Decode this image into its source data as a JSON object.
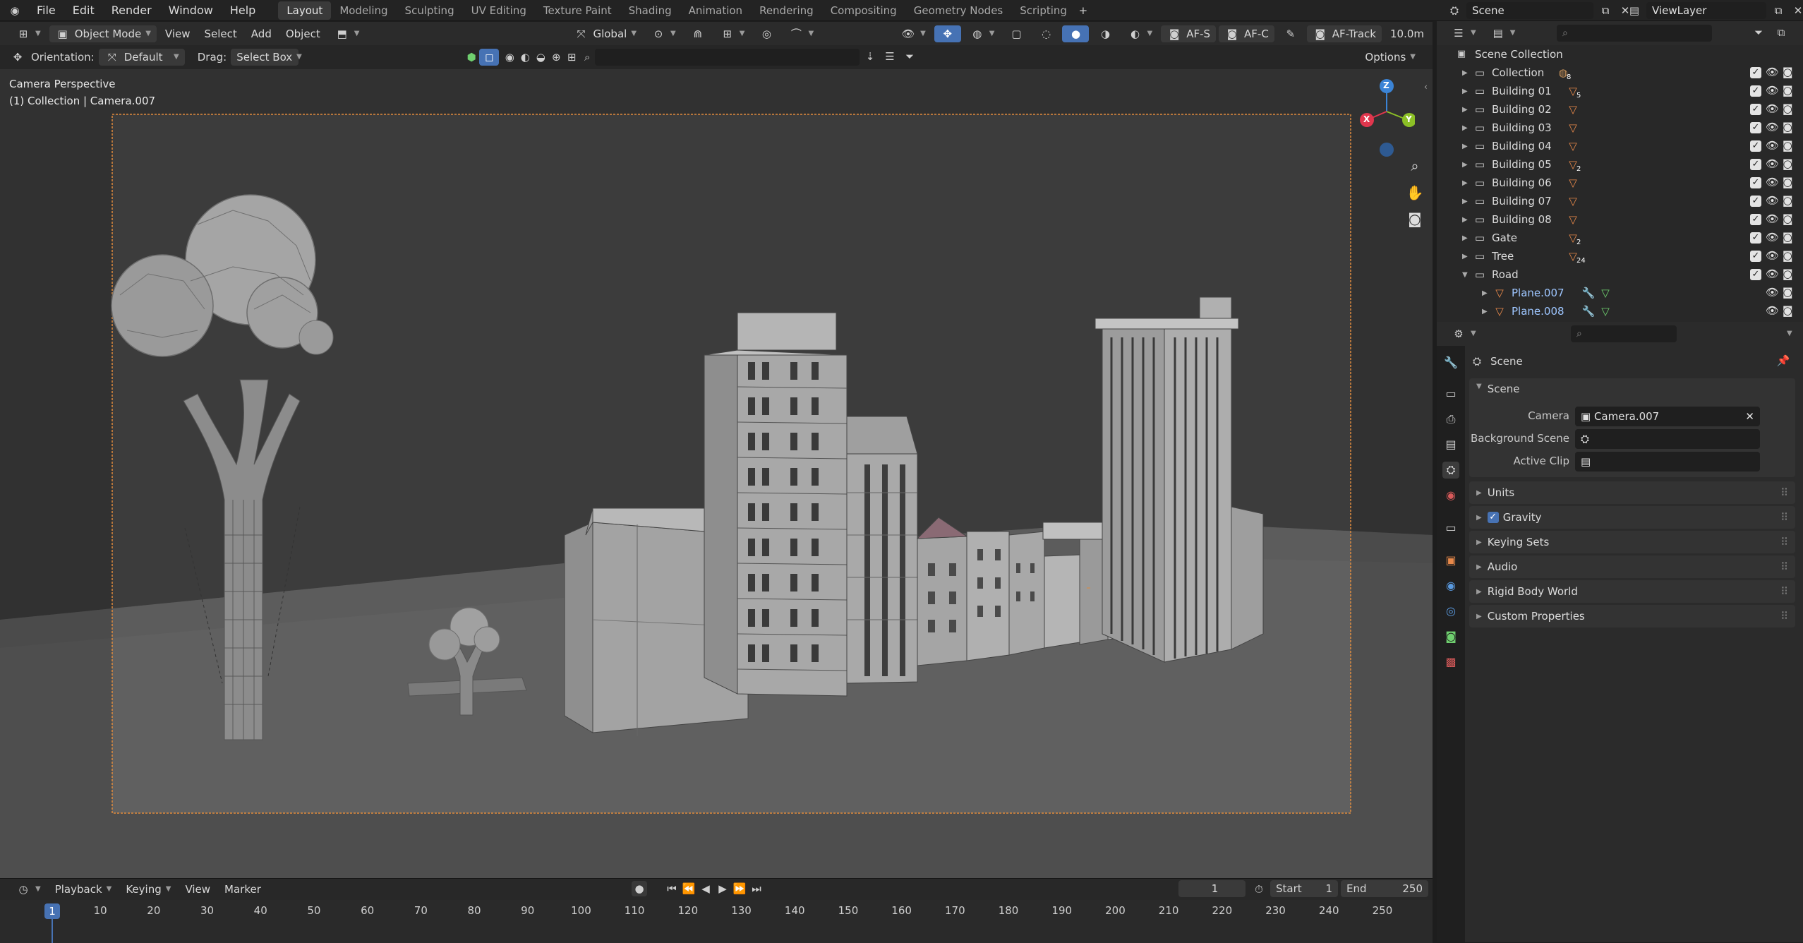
{
  "topbar": {
    "menus": [
      "File",
      "Edit",
      "Render",
      "Window",
      "Help"
    ],
    "workspaces": [
      "Layout",
      "Modeling",
      "Sculpting",
      "UV Editing",
      "Texture Paint",
      "Shading",
      "Animation",
      "Rendering",
      "Compositing",
      "Geometry Nodes",
      "Scripting"
    ],
    "active_workspace": "Layout",
    "scene": "Scene",
    "view_layer": "ViewLayer"
  },
  "header": {
    "mode": "Object Mode",
    "menus": [
      "View",
      "Select",
      "Add",
      "Object"
    ],
    "transform_orientation": "Global",
    "af_s": "AF-S",
    "af_c": "AF-C",
    "af_track": "AF-Track",
    "focus_distance": "10.0m"
  },
  "toolsettings": {
    "orientation_label": "Orientation:",
    "orientation_value": "Default",
    "drag_label": "Drag:",
    "drag_value": "Select Box",
    "options": "Options"
  },
  "viewport": {
    "overlay_title": "Camera Perspective",
    "overlay_subtitle": "(1) Collection | Camera.007",
    "gizmo_axes": [
      "X",
      "Y",
      "Z"
    ]
  },
  "outliner": {
    "root": "Scene Collection",
    "items": [
      {
        "label": "Collection",
        "badge": "8"
      },
      {
        "label": "Building 01",
        "badge": "5"
      },
      {
        "label": "Building 02",
        "badge": ""
      },
      {
        "label": "Building 03",
        "badge": ""
      },
      {
        "label": "Building 04",
        "badge": ""
      },
      {
        "label": "Building 05",
        "badge": "2"
      },
      {
        "label": "Building 06",
        "badge": ""
      },
      {
        "label": "Building 07",
        "badge": ""
      },
      {
        "label": "Building 08",
        "badge": ""
      },
      {
        "label": "Gate",
        "badge": "2"
      },
      {
        "label": "Tree",
        "badge": "24"
      },
      {
        "label": "Road",
        "badge": ""
      },
      {
        "label": "Plane.007",
        "badge": ""
      },
      {
        "label": "Plane.008",
        "badge": ""
      }
    ]
  },
  "properties": {
    "context": "Scene",
    "panel_title": "Scene",
    "camera_label": "Camera",
    "camera_value": "Camera.007",
    "background_label": "Background Scene",
    "clip_label": "Active Clip",
    "panels": [
      "Units",
      "Gravity",
      "Keying Sets",
      "Audio",
      "Rigid Body World",
      "Custom Properties"
    ],
    "gravity_enabled": true
  },
  "timeline": {
    "menus": [
      "Playback",
      "Keying",
      "View",
      "Marker"
    ],
    "current_frame": "1",
    "start_label": "Start",
    "start": "1",
    "end_label": "End",
    "end": "250",
    "ticks": [
      "10",
      "20",
      "30",
      "40",
      "50",
      "60",
      "70",
      "80",
      "90",
      "100",
      "110",
      "120",
      "130",
      "140",
      "150",
      "160",
      "170",
      "180",
      "190",
      "200",
      "210",
      "220",
      "230",
      "240",
      "250"
    ]
  },
  "colors": {
    "accent": "#4772b3",
    "camera_frame": "#e08a3c",
    "gizmo_x": "#e0364d",
    "gizmo_y": "#8cc026",
    "gizmo_z": "#3b84d6",
    "mesh_icon": "#e8894a"
  }
}
